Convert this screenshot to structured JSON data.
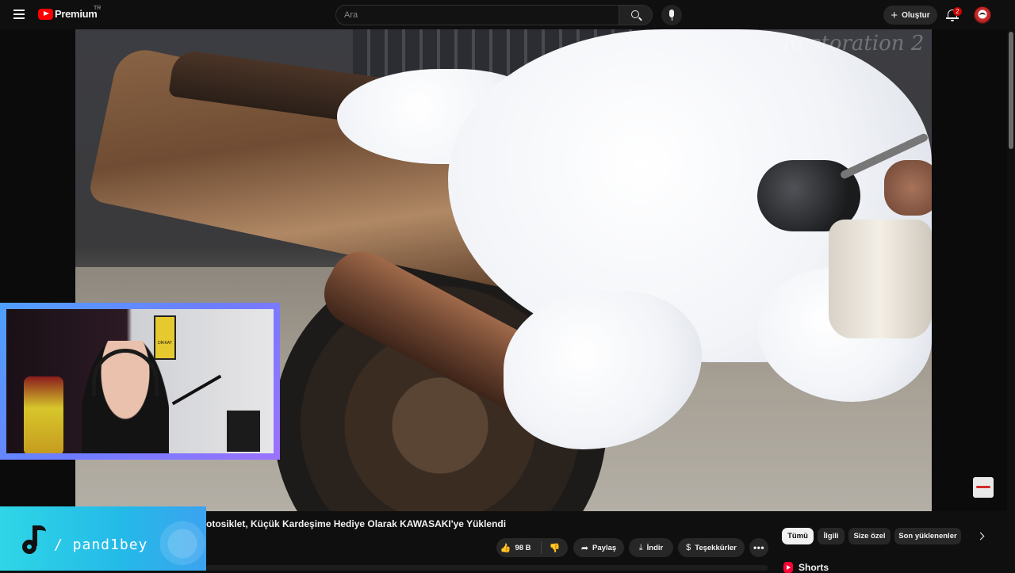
{
  "header": {
    "logo_text": "Premium",
    "country_code": "TR",
    "search_placeholder": "Ara",
    "create_label": "Oluştur",
    "notification_count": "2"
  },
  "video": {
    "watermark": "Restoration 2",
    "title": "otosiklet, Küçük Kardeşime Hediye Olarak KAWASAKI'ye Yüklendi"
  },
  "overlay": {
    "tiktok_handle": "/ pand1bey",
    "sign_text": "DİKKAT"
  },
  "actions": {
    "like_count": "98 B",
    "share_label": "Paylaş",
    "download_label": "İndir",
    "thanks_label": "Teşekkürler",
    "more_label": "•••"
  },
  "chips": [
    "Tümü",
    "İlgili",
    "Size özel",
    "Son yüklenenler"
  ],
  "shelf": {
    "shorts_label": "Shorts"
  },
  "colors": {
    "brand": "#ff0000",
    "background": "#0f0f0f",
    "badge": "#cc0000",
    "tiktok_panel": "#24b9e8"
  },
  "icons": {
    "menu": "hamburger-icon",
    "search": "search-icon",
    "voice": "mic-icon",
    "notifications": "bell-icon",
    "like": "thumbs-up-icon",
    "dislike": "thumbs-down-icon",
    "share": "share-icon",
    "download": "download-icon",
    "thanks": "thanks-icon"
  }
}
